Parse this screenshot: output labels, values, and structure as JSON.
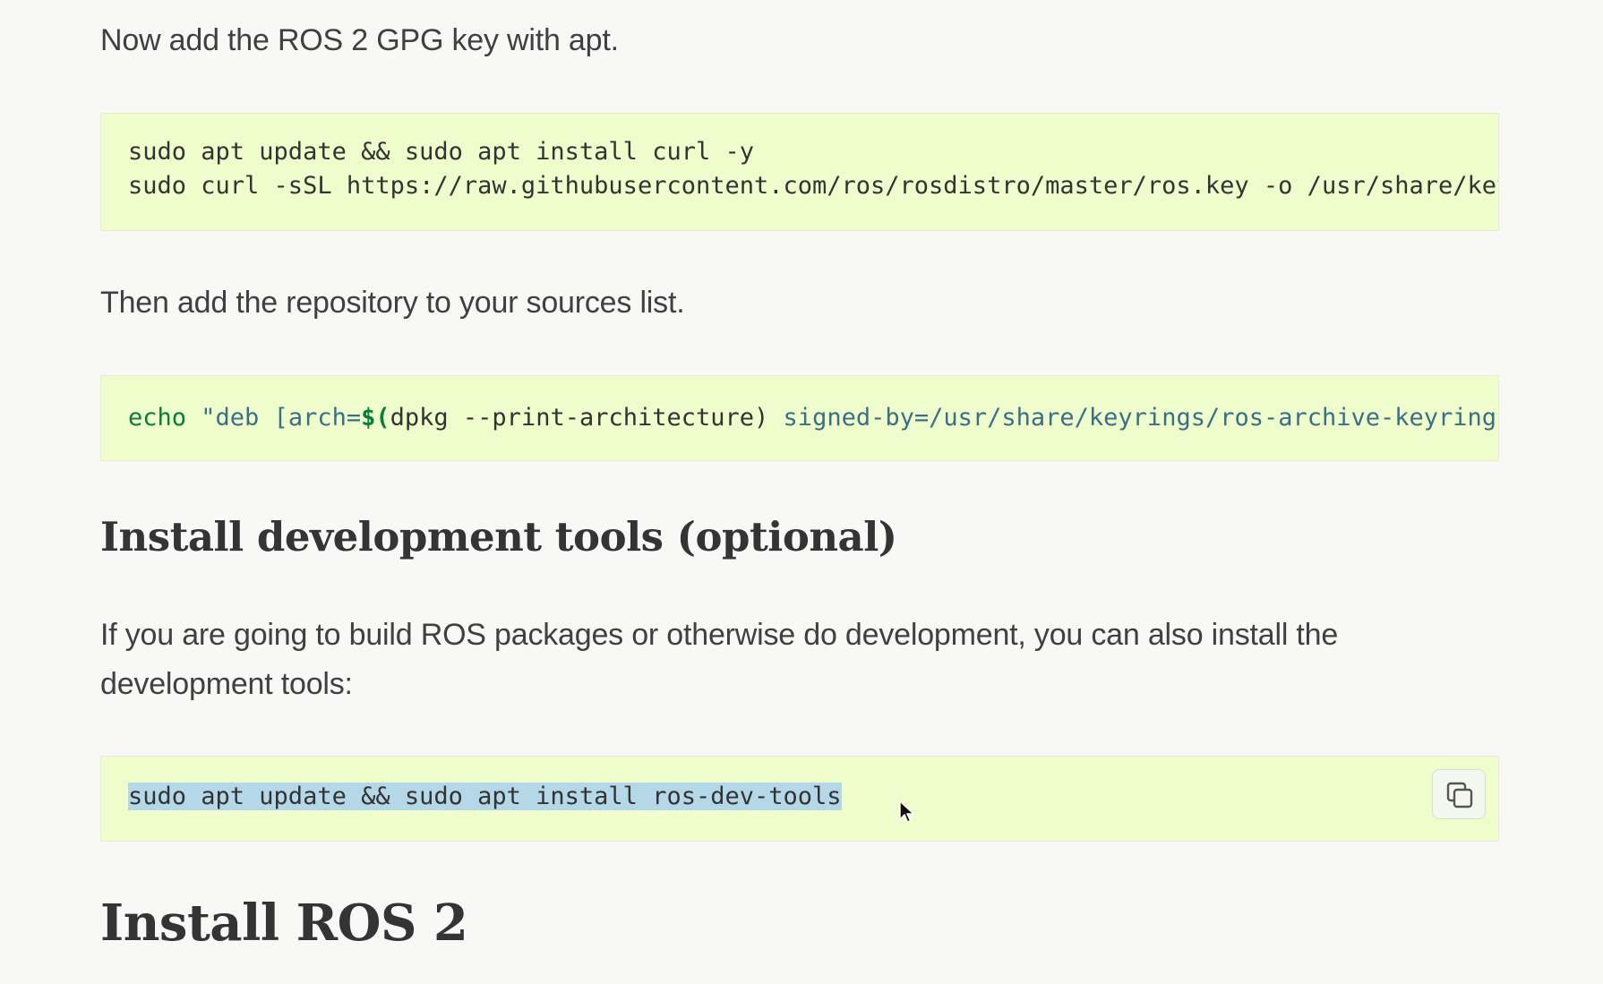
{
  "content": {
    "para_gpg": "Now add the ROS 2 GPG key with apt.",
    "code_gpg": {
      "line1": "sudo apt update && sudo apt install curl -y",
      "line2": "sudo curl -sSL https://raw.githubusercontent.com/ros/rosdistro/master/ros.key -o /usr/share/key"
    },
    "para_repo": "Then add the repository to your sources list.",
    "code_repo": {
      "echo": "echo",
      "quote_deb": " \"deb ",
      "arch_open": "[arch=",
      "dollar_paren": "$(",
      "dpkg_cmd": "dpkg --print-architecture",
      "close_paren": ")",
      "signed_by": " signed-by=/usr/share/keyrings/ros-archive-keyring."
    },
    "heading_dev_tools": "Install development tools (optional)",
    "para_dev_line1": "If you are going to build ROS packages or otherwise do development, you can also install the",
    "para_dev_line2": "development tools:",
    "code_dev": {
      "line1": "sudo apt update && sudo apt install ros-dev-tools",
      "copy_icon": "copy-icon"
    },
    "heading_install": "Install ROS 2"
  },
  "colors": {
    "code_bg": "#eefdcb",
    "selection": "#b4d8e7",
    "keyword_green": "#0b7c3a",
    "string_blue": "#3a6f86"
  }
}
